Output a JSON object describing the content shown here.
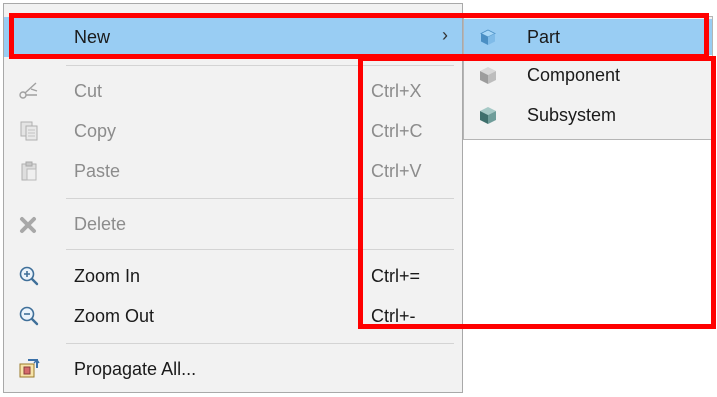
{
  "menu": {
    "new": {
      "label": "New",
      "arrow": "›"
    },
    "items": [
      {
        "label": "Cut",
        "shortcut": "Ctrl+X",
        "icon": "scissors-icon",
        "enabled": false
      },
      {
        "label": "Copy",
        "shortcut": "Ctrl+C",
        "icon": "copy-icon",
        "enabled": false
      },
      {
        "label": "Paste",
        "shortcut": "Ctrl+V",
        "icon": "paste-icon",
        "enabled": false
      },
      {
        "label": "Delete",
        "shortcut": "",
        "icon": "delete-x-icon",
        "enabled": false
      },
      {
        "label": "Zoom In",
        "shortcut": "Ctrl+=",
        "icon": "zoom-in-icon",
        "enabled": true
      },
      {
        "label": "Zoom Out",
        "shortcut": "Ctrl+-",
        "icon": "zoom-out-icon",
        "enabled": true
      },
      {
        "label": "Propagate All...",
        "shortcut": "",
        "icon": "propagate-icon",
        "enabled": true
      }
    ]
  },
  "submenu": {
    "items": [
      {
        "label": "Part",
        "icon": "part-cube-icon",
        "highlighted": true
      },
      {
        "label": "Component",
        "icon": "component-cube-icon",
        "highlighted": false
      },
      {
        "label": "Subsystem",
        "icon": "subsystem-cube-icon",
        "highlighted": false
      }
    ]
  },
  "colors": {
    "highlight": "#99cdf3",
    "annotation": "#ff0000",
    "menu_background": "#f2f2f2"
  }
}
